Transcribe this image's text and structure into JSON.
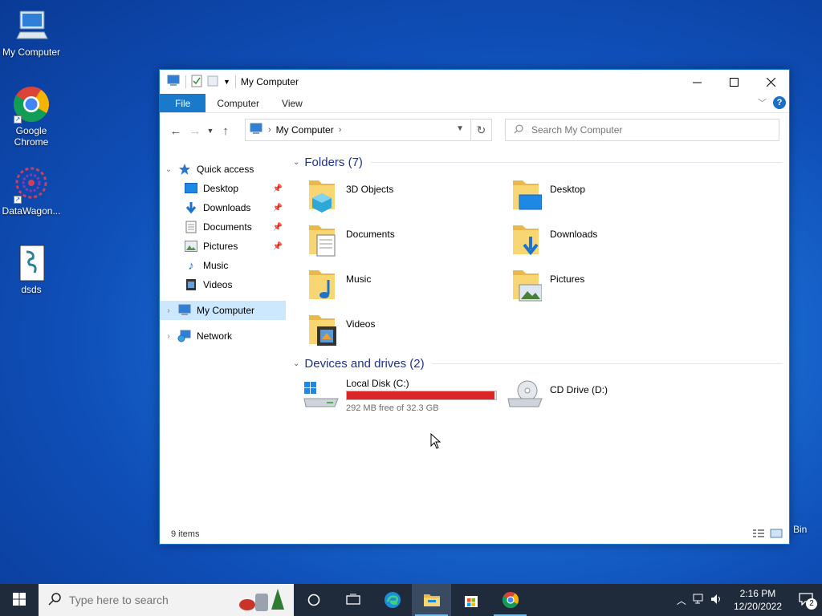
{
  "desktop": {
    "icons": [
      {
        "label": "My Computer",
        "icon": "computer-icon"
      },
      {
        "label": "Google Chrome",
        "icon": "chrome-icon"
      },
      {
        "label": "DataWagon...",
        "icon": "datawagon-icon"
      },
      {
        "label": "dsds",
        "icon": "file-icon"
      }
    ],
    "recycle_bin_label": "Bin"
  },
  "window": {
    "title": "My Computer",
    "ribbon_tabs": [
      "File",
      "Computer",
      "View"
    ],
    "address": {
      "path": "My Computer"
    },
    "search": {
      "placeholder": "Search My Computer"
    },
    "nav": {
      "quick_access": "Quick access",
      "quick_items": [
        "Desktop",
        "Downloads",
        "Documents",
        "Pictures",
        "Music",
        "Videos"
      ],
      "my_computer": "My Computer",
      "network": "Network"
    },
    "folders_header": "Folders (7)",
    "folders": [
      "3D Objects",
      "Desktop",
      "Documents",
      "Downloads",
      "Music",
      "Pictures",
      "Videos"
    ],
    "drives_header": "Devices and drives (2)",
    "drives": [
      {
        "name": "Local Disk (C:)",
        "free_text": "292 MB free of 32.3 GB",
        "used_fraction": 0.991
      },
      {
        "name": "CD Drive (D:)"
      }
    ],
    "status": "9 items"
  },
  "taskbar": {
    "search_placeholder": "Type here to search",
    "time": "2:16 PM",
    "date": "12/20/2022",
    "notification_count": "2"
  }
}
